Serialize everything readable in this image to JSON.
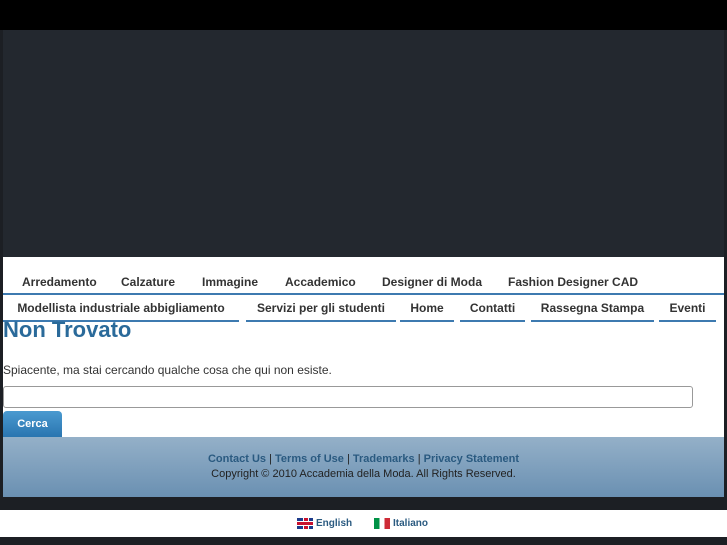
{
  "nav": {
    "row1": [
      "Arredamento",
      "Calzature",
      "Immagine",
      "Accademico",
      "Designer di Moda",
      "Fashion Designer CAD"
    ],
    "row2": [
      "Modellista industriale abbigliamento",
      "Servizi per gli studenti",
      "Home",
      "Contatti",
      "Rassegna Stampa",
      "Eventi"
    ]
  },
  "main": {
    "title": "Non Trovato",
    "message": "Spiacente, ma stai cercando qualche cosa che qui non esiste.",
    "search_value": "",
    "search_button": "Cerca"
  },
  "footer": {
    "links": [
      "Contact Us",
      "Terms of Use",
      "Trademarks",
      "Privacy Statement"
    ],
    "separator": "|",
    "copyright": "Copyright © 2010 Accademia della Moda. All Rights Reserved."
  },
  "languages": [
    {
      "label": "English",
      "icon": "uk-flag-icon"
    },
    {
      "label": "Italiano",
      "icon": "italy-flag-icon"
    }
  ]
}
